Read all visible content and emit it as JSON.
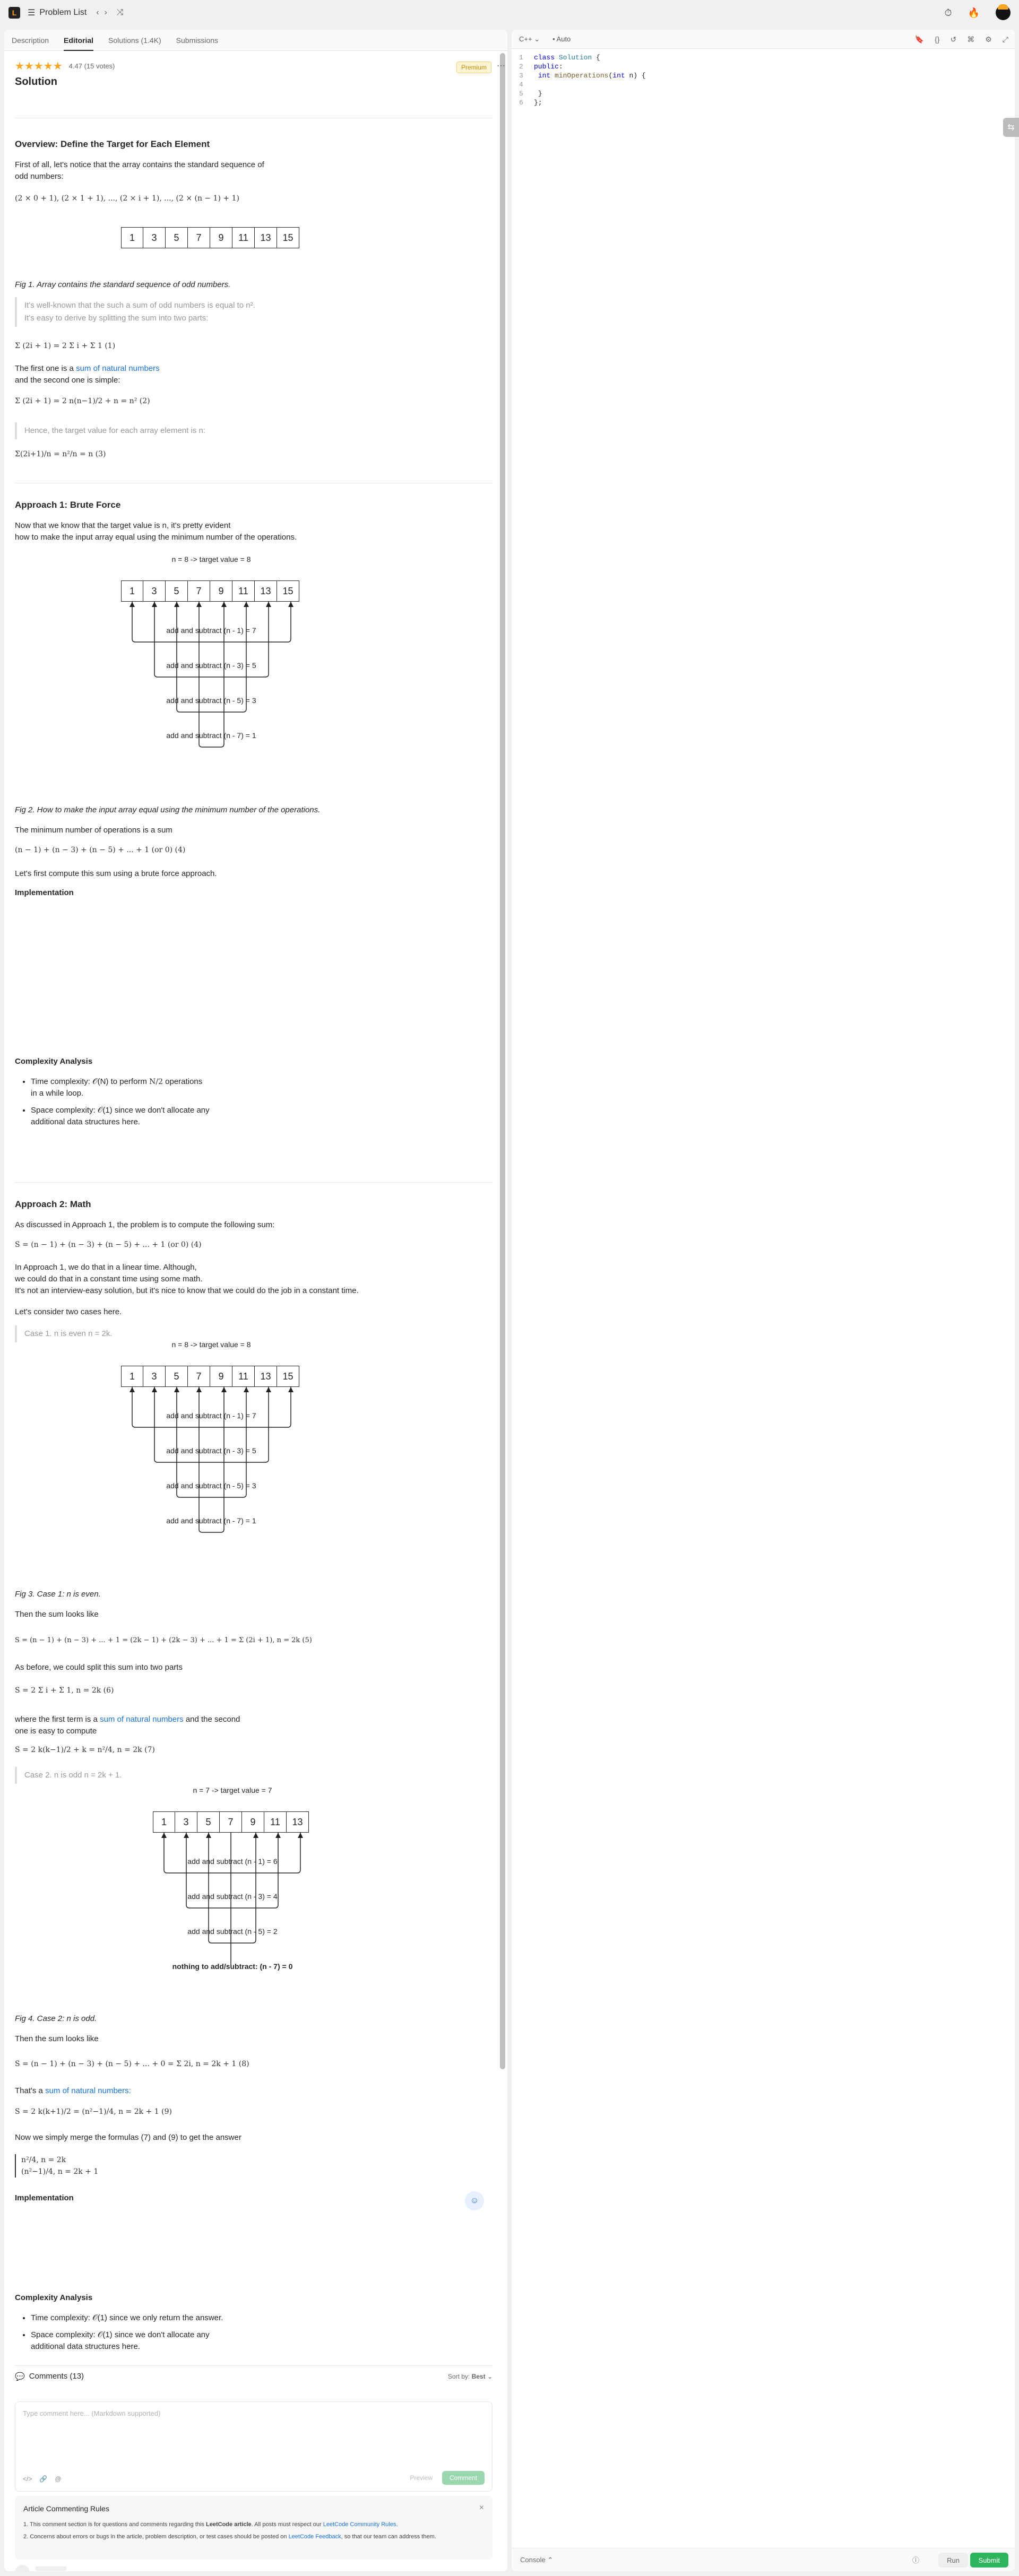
{
  "topbar": {
    "logo": "L",
    "problem_list": "Problem List",
    "prev": "‹",
    "next": "›",
    "shuffle": "⤨"
  },
  "tabs": [
    {
      "label": "Description"
    },
    {
      "label": "Editorial"
    },
    {
      "label": "Solutions (1.4K)"
    },
    {
      "label": "Submissions"
    }
  ],
  "header": {
    "stars": "★★★★★",
    "rating": "4.47 (15 votes)",
    "premium": "Premium",
    "title": "Solution"
  },
  "overview": {
    "heading": "Overview: Define the Target for Each Element",
    "p1a": "First of all, let's notice that the array contains the standard sequence of",
    "p1b": "odd numbers:",
    "seq": "(2 × 0 + 1), (2 × 1 + 1), ..., (2 × i + 1), ..., (2 × (n − 1) + 1)",
    "array": [
      "1",
      "3",
      "5",
      "7",
      "9",
      "11",
      "13",
      "15"
    ],
    "fig1": "Fig 1. Array contains the standard sequence of odd numbers.",
    "q1a": "It's well-known that the such a sum of odd numbers is equal to n².",
    "q1b": "It's easy to derive by splitting the sum into two parts:",
    "eq1": "Σ (2i + 1) = 2 Σ i + Σ 1        (1)",
    "p2a": "The first one is a",
    "p2link": "sum of natural numbers",
    "p2b": "and the second one is simple:",
    "eq2": "Σ (2i + 1) = 2 n(n−1)/2 + n = n²        (2)",
    "q2": "Hence, the target value for each array element is n:",
    "eq3": "Σ(2i+1)/n = n²/n = n        (3)"
  },
  "approach1": {
    "heading": "Approach 1: Brute Force",
    "p1a": "Now that we know that the target value is n, it's pretty evident",
    "p1b": "how to make the input array equal using the minimum number of the operations.",
    "diag_title": "n = 8 -> target value = 8",
    "labels": [
      "add and subtract (n - 1) = 7",
      "add and subtract (n - 3) = 5",
      "add and subtract (n - 5) = 3",
      "add and subtract (n - 7) = 1"
    ],
    "fig2": "Fig 2. How to make the input array equal using the minimum number of the operations.",
    "p2": "The minimum number of operations is a sum",
    "eq4": "(n − 1) + (n − 3) + (n − 5) + ... + 1 (or 0)        (4)",
    "p3": "Let's first compute this sum using a brute force approach.",
    "impl": "Implementation",
    "complexity": "Complexity Analysis",
    "time_a": "Time complexity: 𝒪(N) to perform",
    "time_frac": "N/2",
    "time_b": "operations",
    "time_c": "in a while loop.",
    "space_a": "Space complexity: 𝒪(1) since we don't allocate any",
    "space_b": "additional data structures here."
  },
  "approach2": {
    "heading": "Approach 2: Math",
    "p1": "As discussed in Approach 1, the problem is to compute the following sum:",
    "eq4": "S = (n − 1) + (n − 3) + (n − 5) + ... + 1 (or 0)        (4)",
    "p2a": "In Approach 1, we do that in a linear time. Although,",
    "p2b": "we could do that in a constant time using some math.",
    "p2c": "It's not an interview-easy solution, but it's nice to know that we could do the job in a constant time.",
    "p3": "Let's consider two cases here.",
    "case1": "Case 1. n is even n = 2k.",
    "diag_title": "n = 8 -> target value = 8",
    "labels": [
      "add and subtract (n - 1) = 7",
      "add and subtract (n - 3) = 5",
      "add and subtract (n - 5) = 3",
      "add and subtract (n - 7) = 1"
    ],
    "fig3": "Fig 3. Case 1: n is even.",
    "p4": "Then the sum looks like",
    "eq5": "S = (n − 1) + (n − 3) + ... + 1 = (2k − 1) + (2k − 3) + ... + 1 = Σ (2i + 1),        n = 2k        (5)",
    "p5": "As before, we could split this sum into two parts",
    "eq6": "S = 2 Σ i + Σ 1,        n = 2k        (6)",
    "p6a": "where the first term is a",
    "p6link": "sum of natural numbers",
    "p6b": "and the second",
    "p6c": "one is easy to compute",
    "eq7": "S = 2 k(k−1)/2 + k = n²/4,        n = 2k        (7)",
    "case2": "Case 2. n is odd n = 2k + 1.",
    "diag2_title": "n = 7 -> target value = 7",
    "array2": [
      "1",
      "3",
      "5",
      "7",
      "9",
      "11",
      "13"
    ],
    "labels2": [
      "add and subtract (n - 1) = 6",
      "add and subtract (n - 3) = 4",
      "add and subtract (n - 5) = 2",
      "nothing to add/subtract: (n - 7) = 0"
    ],
    "fig4": "Fig 4. Case 2: n is odd.",
    "p7": "Then the sum looks like",
    "eq8": "S = (n − 1) + (n − 3) + (n − 5) + ... + 0 = Σ 2i,        n = 2k + 1        (8)",
    "p8a": "That's a",
    "p8link": "sum of natural numbers:",
    "eq9": "S = 2 k(k+1)/2 = (n²−1)/4,        n = 2k + 1        (9)",
    "p9": "Now we simply merge the formulas (7) and (9) to get the answer",
    "eq10a": "n²/4,        n = 2k",
    "eq10b": "(n²−1)/4,    n = 2k + 1",
    "impl": "Implementation",
    "complexity": "Complexity Analysis",
    "time": "Time complexity: 𝒪(1) since we only return the answer.",
    "space_a": "Space complexity: 𝒪(1) since we don't allocate any",
    "space_b": "additional data structures here."
  },
  "comments": {
    "title": "Comments (13)",
    "sort_label": "Sort by:",
    "sort_value": "Best",
    "placeholder": "Type comment here... (Markdown supported)",
    "preview": "Preview",
    "comment_btn": "Comment",
    "rules_title": "Article Commenting Rules",
    "rule1a": "1. This comment section is for questions and comments regarding this",
    "rule1b": "LeetCode article",
    "rule1c": ". All posts must respect our",
    "rule1d": "LeetCode Community Rules",
    "rule2a": "2. Concerns about errors or bugs in the article, problem description, or test cases should be posted on",
    "rule2b": "LeetCode Feedback",
    "rule2c": ", so that our team can address them."
  },
  "editor": {
    "lang": "C++",
    "auto": "Auto",
    "lines": [
      "1",
      "2",
      "3",
      "4",
      "5",
      "6"
    ],
    "console": "Console",
    "run": "Run",
    "submit": "Submit"
  }
}
